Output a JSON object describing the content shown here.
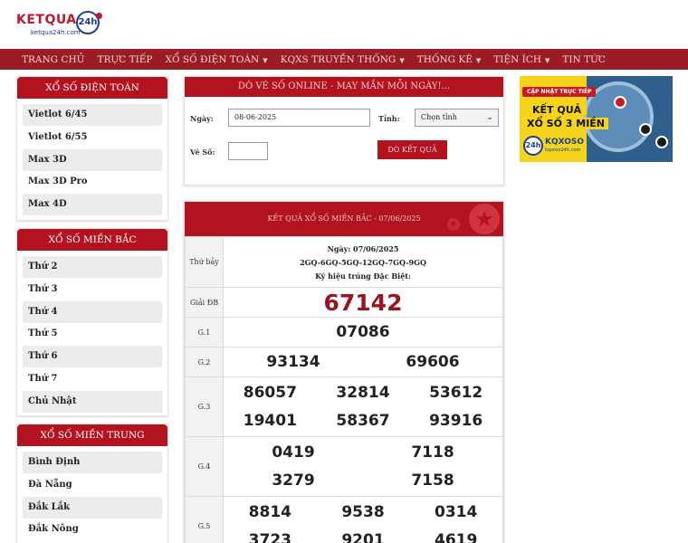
{
  "header": {
    "logo_brand": "KETQUA",
    "logo_badge": "24h",
    "logo_domain": "ketqua24h.com"
  },
  "nav": {
    "items": [
      {
        "label": "TRANG CHỦ",
        "dropdown": false
      },
      {
        "label": "TRỰC TIẾP",
        "dropdown": false
      },
      {
        "label": "XỔ SỐ ĐIỆN TOÁN",
        "dropdown": true
      },
      {
        "label": "KQXS TRUYỀN THỐNG",
        "dropdown": true
      },
      {
        "label": "THỐNG KÊ",
        "dropdown": true
      },
      {
        "label": "TIỆN ÍCH",
        "dropdown": true
      },
      {
        "label": "TIN TỨC",
        "dropdown": false
      }
    ]
  },
  "sidebar": {
    "dien_toan": {
      "title": "XỔ SỐ ĐIỆN TOÁN",
      "items": [
        "Vietlot 6/45",
        "Vietlot 6/55",
        "Max 3D",
        "Max 3D Pro",
        "Max 4D"
      ]
    },
    "mien_bac": {
      "title": "XỔ SỐ MIỀN BẮC",
      "items": [
        "Thứ 2",
        "Thứ 3",
        "Thứ 4",
        "Thứ 5",
        "Thứ 6",
        "Thứ 7",
        "Chủ Nhật"
      ]
    },
    "mien_trung": {
      "title": "XỔ SỐ MIỀN TRUNG",
      "items": [
        "Bình Định",
        "Đà Nẵng",
        "Đắk Lắk",
        "Đắk Nông"
      ]
    }
  },
  "do_ve_so": {
    "title": "DÒ VÉ SỐ ONLINE - MAY MẮN MỖI NGÀY!...",
    "date_label": "Ngày:",
    "date_value": "08-06-2025",
    "province_label": "Tỉnh:",
    "province_value": "Chọn tỉnh",
    "ticket_label": "Vé Số:",
    "ticket_value": "",
    "submit_label": "DÒ KẾT QUẢ"
  },
  "result": {
    "title": "KẾT QUẢ XỔ SỐ MIỀN BẮC - 07/06/2025",
    "day": "Thứ bảy",
    "date_line": "Ngày: 07/06/2025",
    "codes": "2GQ-6GQ-5GQ-12GQ-7GQ-9GQ",
    "special_note": "Ký hiệu trúng Đặc Biệt:",
    "prizes": {
      "db": {
        "label": "Giải ĐB",
        "numbers": [
          "67142"
        ]
      },
      "g1": {
        "label": "G.1",
        "numbers": [
          "07086"
        ]
      },
      "g2": {
        "label": "G.2",
        "numbers": [
          "93134",
          "69606"
        ]
      },
      "g3": {
        "label": "G.3",
        "numbers": [
          "86057",
          "32814",
          "53612",
          "19401",
          "58367",
          "93916"
        ]
      },
      "g4": {
        "label": "G.4",
        "numbers": [
          "0419",
          "7118",
          "3279",
          "7158"
        ]
      },
      "g5": {
        "label": "G.5",
        "numbers": [
          "8814",
          "9538",
          "0314",
          "3723",
          "9201",
          "4619"
        ]
      }
    }
  },
  "ad": {
    "pill": "CẬP NHẬT TRỰC TIẾP",
    "line1": "KẾT QUẢ",
    "line2": "XỔ SỐ 3 MIỀN",
    "logo_badge": "24h",
    "brand": "KQXOSO",
    "url": "kqxoso24h.com"
  }
}
